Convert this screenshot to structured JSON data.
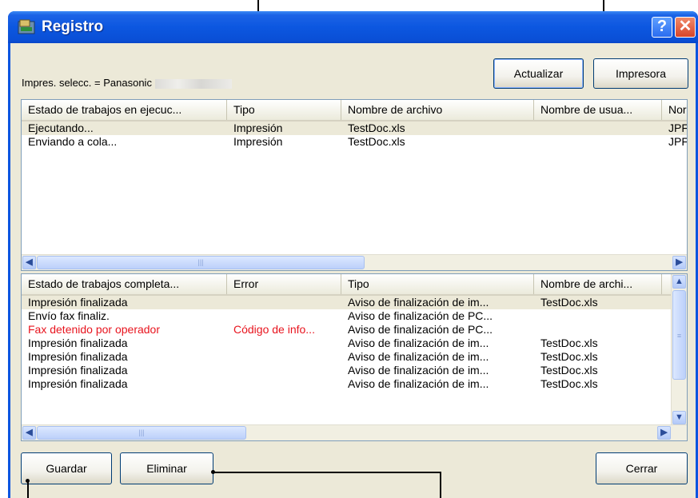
{
  "window": {
    "title": "Registro",
    "help_glyph": "?",
    "close_glyph": "✕"
  },
  "printer": {
    "label": "Impres. selecc. = Panasonic"
  },
  "buttons": {
    "update": "Actualizar",
    "printer": "Impresora",
    "save": "Guardar",
    "delete": "Eliminar",
    "close": "Cerrar"
  },
  "running": {
    "headers": [
      "Estado de trabajos en ejecuc...",
      "Tipo",
      "Nombre de archivo",
      "Nombre de usua...",
      "Nor"
    ],
    "rows": [
      [
        "Ejecutando...",
        "Impresión",
        "TestDoc.xls",
        "",
        "JPF"
      ],
      [
        "Enviando a cola...",
        "Impresión",
        "TestDoc.xls",
        "",
        "JPF"
      ]
    ]
  },
  "completed": {
    "headers": [
      "Estado de trabajos completa...",
      "Error",
      "Tipo",
      "Nombre de archi..."
    ],
    "rows": [
      [
        "Impresión finalizada",
        "",
        "Aviso de finalización de im...",
        "TestDoc.xls"
      ],
      [
        "Envío fax finaliz.",
        "",
        "Aviso de finalización de PC...",
        ""
      ],
      [
        "Fax detenido por operador",
        "Código de info...",
        "Aviso de finalización de PC...",
        ""
      ],
      [
        "Impresión finalizada",
        "",
        "Aviso de finalización de im...",
        "TestDoc.xls"
      ],
      [
        "Impresión finalizada",
        "",
        "Aviso de finalización de im...",
        "TestDoc.xls"
      ],
      [
        "Impresión finalizada",
        "",
        "Aviso de finalización de im...",
        "TestDoc.xls"
      ],
      [
        "Impresión finalizada",
        "",
        "Aviso de finalización de im...",
        "TestDoc.xls"
      ]
    ],
    "error_color": "#e8141e"
  },
  "icons": {
    "app": "app-icon",
    "left": "arrow-left-icon",
    "right": "arrow-right-icon",
    "up": "arrow-up-icon",
    "down": "arrow-down-icon"
  }
}
